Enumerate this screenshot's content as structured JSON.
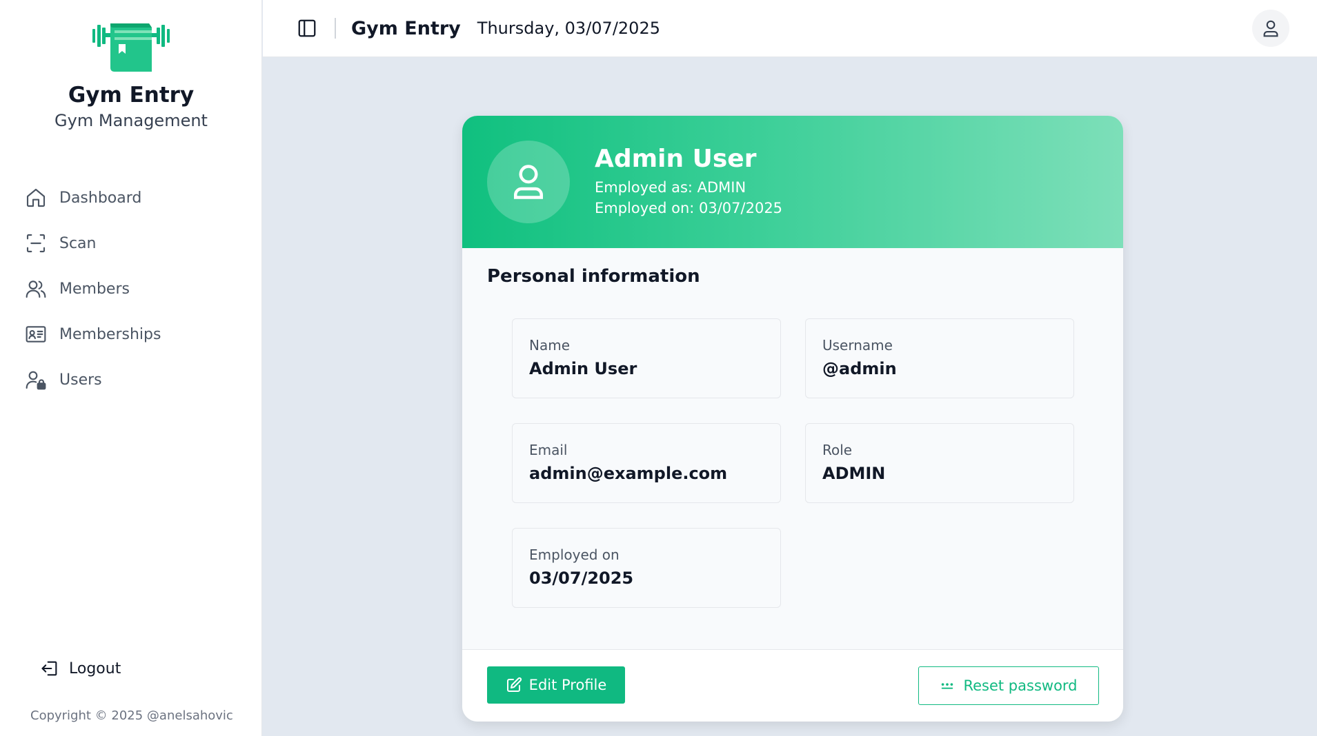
{
  "brand": {
    "title": "Gym Entry",
    "subtitle": "Gym Management",
    "logo_icon": "dumbbell-book-logo",
    "accent": "#10b981"
  },
  "sidebar": {
    "items": [
      {
        "label": "Dashboard",
        "icon": "home-icon"
      },
      {
        "label": "Scan",
        "icon": "scan-icon"
      },
      {
        "label": "Members",
        "icon": "users-icon"
      },
      {
        "label": "Memberships",
        "icon": "id-card-icon"
      },
      {
        "label": "Users",
        "icon": "user-lock-icon"
      }
    ],
    "logout_label": "Logout",
    "copyright": "Copyright © 2025 @anelsahovic"
  },
  "header": {
    "title": "Gym Entry",
    "date": "Thursday, 03/07/2025"
  },
  "profile": {
    "name": "Admin User",
    "employed_as": "Employed as: ADMIN",
    "employed_on": "Employed on: 03/07/2025",
    "section_title": "Personal information",
    "fields": [
      {
        "label": "Name",
        "value": "Admin User"
      },
      {
        "label": "Username",
        "value": "@admin"
      },
      {
        "label": "Email",
        "value": "admin@example.com"
      },
      {
        "label": "Role",
        "value": "ADMIN"
      },
      {
        "label": "Employed on",
        "value": "03/07/2025"
      }
    ],
    "edit_label": "Edit Profile",
    "reset_label": "Reset password"
  }
}
